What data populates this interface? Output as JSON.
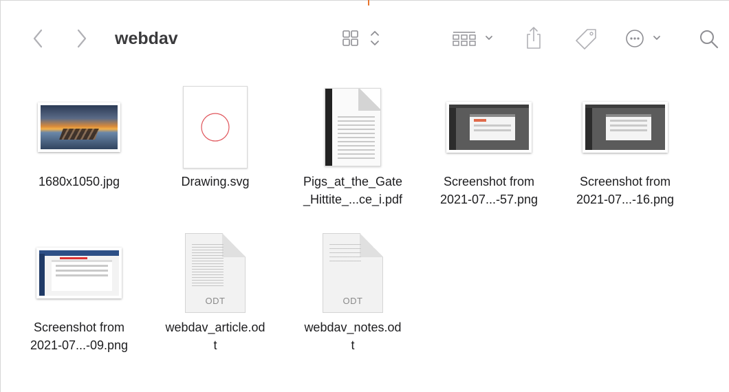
{
  "toolbar": {
    "title": "webdav",
    "icons": {
      "back": "chevron-left-icon",
      "forward": "chevron-right-icon",
      "view": "icon-grid-view-icon",
      "group": "group-by-icon",
      "share": "share-icon",
      "tag": "tag-icon",
      "more": "ellipsis-circle-icon",
      "search": "magnifier-icon"
    }
  },
  "files": [
    {
      "name": "1680x1050.jpg",
      "kind": "photo"
    },
    {
      "name": "Drawing.svg",
      "kind": "svg"
    },
    {
      "name": "Pigs_at_the_Gate\n_Hittite_...ce_i.pdf",
      "kind": "pdf"
    },
    {
      "name": "Screenshot from\n2021-07...-57.png",
      "kind": "shot"
    },
    {
      "name": "Screenshot from\n2021-07...-16.png",
      "kind": "shot"
    },
    {
      "name": "Screenshot from\n2021-07...-09.png",
      "kind": "shot-blue"
    },
    {
      "name": "webdav_article.od\nt",
      "kind": "odt",
      "badge": "ODT"
    },
    {
      "name": "webdav_notes.od\nt",
      "kind": "odt-sparse",
      "badge": "ODT"
    }
  ],
  "colors": {
    "accent": "#e8742c",
    "icon_gray": "#8e8e93",
    "svg_circle": "#e0545a"
  }
}
